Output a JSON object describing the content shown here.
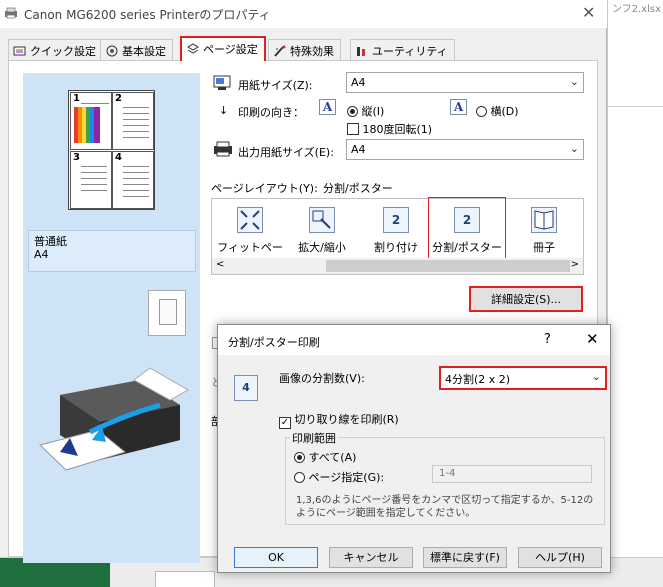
{
  "background": {
    "right_text": "ンフ2.xlsx"
  },
  "window": {
    "title": "Canon MG6200 series Printerのプロパティ",
    "close_glyph": "✕"
  },
  "tabs": [
    {
      "label": "クイック設定",
      "icon": "quick-setup-icon"
    },
    {
      "label": "基本設定",
      "icon": "main-settings-icon"
    },
    {
      "label": "ページ設定",
      "icon": "page-setup-icon",
      "selected": true
    },
    {
      "label": "特殊効果",
      "icon": "special-effects-icon"
    },
    {
      "label": "ユーティリティ",
      "icon": "utility-icon"
    }
  ],
  "preview": {
    "quadrants": [
      "1",
      "2",
      "3",
      "4"
    ],
    "paper_type": "普通紙",
    "paper_size": "A4"
  },
  "page_setup": {
    "page_size_label": "用紙サイズ(Z):",
    "page_size_value": "A4",
    "orientation_label": "印刷の向き：",
    "portrait_label": "縦(I)",
    "landscape_label": "横(D)",
    "rotate_label": "180度回転(1)",
    "a_glyph": "A",
    "output_size_label": "出力用紙サイズ(E):",
    "output_size_value": "A4",
    "layout_label": "ページレイアウト(Y):",
    "layout_value": "分割/ポスター",
    "layout_items": [
      {
        "label": "フィットページ",
        "icon": "fit-page-icon",
        "glyph": ""
      },
      {
        "label": "拡大/縮小",
        "icon": "scale-icon",
        "glyph": ""
      },
      {
        "label": "割り付け",
        "icon": "page-layout-icon",
        "glyph": "2"
      },
      {
        "label": "分割/ポスター",
        "icon": "tiling-poster-icon",
        "glyph": "2"
      },
      {
        "label": "冊子",
        "icon": "booklet-icon",
        "glyph": ""
      }
    ],
    "scroll_left": "<",
    "scroll_right": ">",
    "detail_button": "詳細設定(S)...",
    "hidden_fragment_1": "と",
    "hidden_fragment_2": "部"
  },
  "dialog": {
    "title": "分割/ポスター印刷",
    "help_glyph": "?",
    "close_glyph": "✕",
    "icon_glyph": "4",
    "divisions_label": "画像の分割数(V):",
    "divisions_value": "4分割(2 x 2)",
    "cut_lines_label": "切り取り線を印刷(R)",
    "print_range_title": "印刷範囲",
    "all_label": "すべて(A)",
    "page_spec_label": "ページ指定(G):",
    "page_spec_value": "1-4",
    "note_line1": "1,3,6のようにページ番号をカンマで区切って指定するか、5-12の",
    "note_line2": "ようにページ範囲を指定してください。",
    "buttons": {
      "ok": "OK",
      "cancel": "キャンセル",
      "defaults": "標準に戻す(F)",
      "help": "ヘルプ(H)"
    }
  },
  "colors": {
    "highlight_red": "#e02020",
    "preview_blue": "#cfe3f7"
  }
}
